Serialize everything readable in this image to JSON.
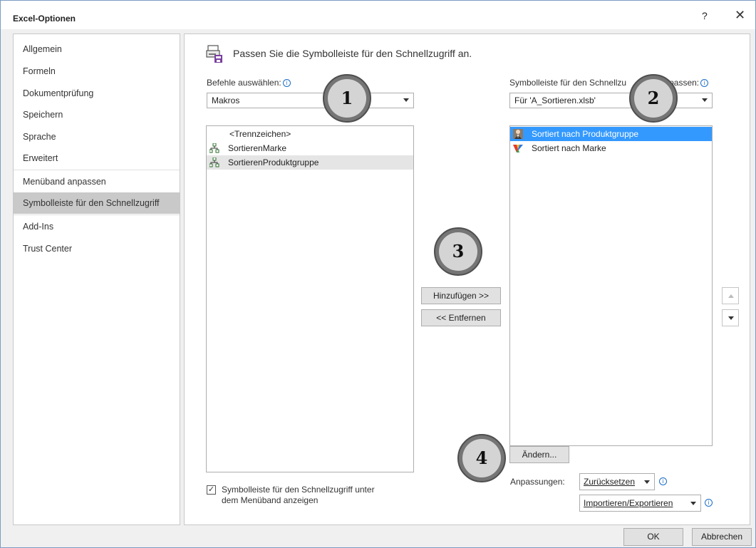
{
  "window": {
    "title": "Excel-Optionen",
    "help_label": "?",
    "close_label": "✕"
  },
  "nav": {
    "items": [
      {
        "label": "Allgemein"
      },
      {
        "label": "Formeln"
      },
      {
        "label": "Dokumentprüfung"
      },
      {
        "label": "Speichern"
      },
      {
        "label": "Sprache"
      },
      {
        "label": "Erweitert"
      },
      {
        "label": "Menüband anpassen"
      },
      {
        "label": "Symbolleiste für den Schnellzugriff",
        "selected": true
      },
      {
        "label": "Add-Ins"
      },
      {
        "label": "Trust Center"
      }
    ]
  },
  "main": {
    "heading": "Passen Sie die Symbolleiste für den Schnellzugriff an.",
    "commands_label": "Befehle auswählen:",
    "commands_value": "Makros",
    "toolbar_label": "Symbolleiste für den Schnellzu",
    "toolbar_label_tail": "passen:",
    "toolbar_value": "Für 'A_Sortieren.xlsb'",
    "info_icon": "ⓘ",
    "left_list": [
      {
        "label": "<Trennzeichen>",
        "icon": "none"
      },
      {
        "label": "SortierenMarke",
        "icon": "macro-icon"
      },
      {
        "label": "SortierenProduktgruppe",
        "icon": "macro-icon",
        "highlighted": true
      }
    ],
    "right_list": [
      {
        "label": "Sortiert nach Produktgruppe",
        "icon": "person-icon",
        "selected": true
      },
      {
        "label": "Sortiert nach Marke",
        "icon": "colorful-v-icon"
      }
    ],
    "add_button": "Hinzufügen >>",
    "remove_button": "<< Entfernen",
    "modify_button": "Ändern...",
    "customizations_label": "Anpassungen:",
    "reset_button": "Zurücksetzen",
    "import_export_button": "Importieren/Exportieren",
    "checkbox_line1": "Symbolleiste für den Schnellzugriff unter",
    "checkbox_line2": "dem Menüband anzeigen",
    "checkbox_checked": true
  },
  "callouts": [
    "1",
    "2",
    "3",
    "4"
  ],
  "footer": {
    "ok_label": "OK",
    "cancel_label": "Abbrechen"
  },
  "colors": {
    "selection_blue": "#3399ff",
    "nav_selected": "#c9c9c9",
    "info_blue": "#1a6cc8"
  }
}
